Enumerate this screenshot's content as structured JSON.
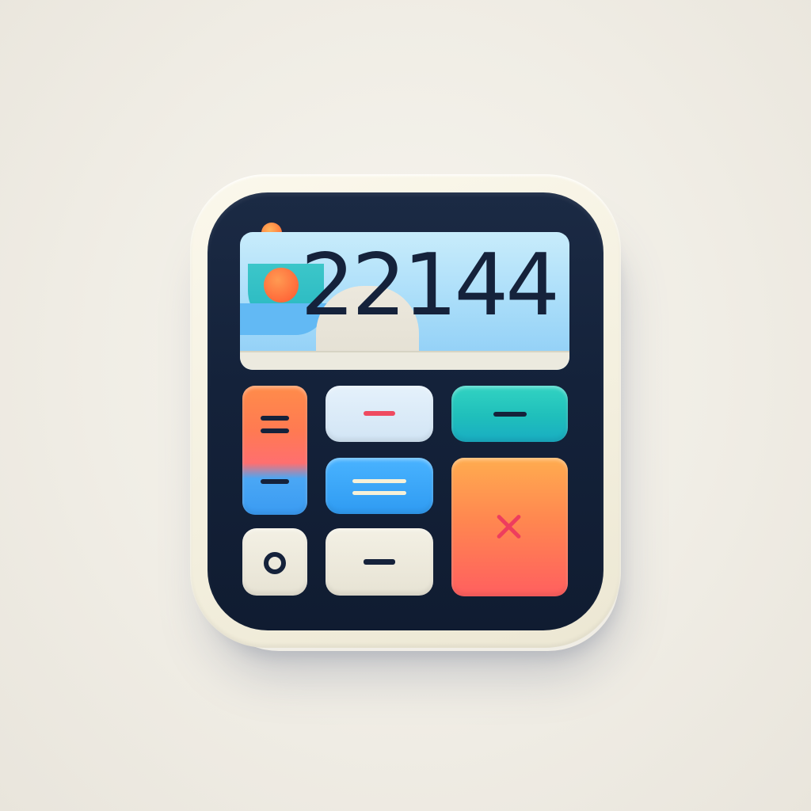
{
  "app_icon": {
    "display_value": "22144"
  },
  "keys": [
    {
      "name": "equals-key",
      "symbol": "equals-icon"
    },
    {
      "name": "minus-key-red",
      "symbol": "minus-icon"
    },
    {
      "name": "minus-key-teal",
      "symbol": "minus-icon"
    },
    {
      "name": "equals-key-blue",
      "symbol": "equals-icon"
    },
    {
      "name": "multiply-key",
      "symbol": "close-x-icon"
    },
    {
      "name": "circle-key",
      "symbol": "circle-icon"
    },
    {
      "name": "minus-key-cream",
      "symbol": "minus-icon"
    }
  ],
  "colors": {
    "body": "#14223a",
    "frame": "#f3efde",
    "display": "#a7dcf9",
    "accent_orange": "#ff7a3c",
    "accent_teal": "#1fbfbb",
    "accent_blue": "#2f9bf2",
    "accent_red": "#ee3d5e"
  }
}
